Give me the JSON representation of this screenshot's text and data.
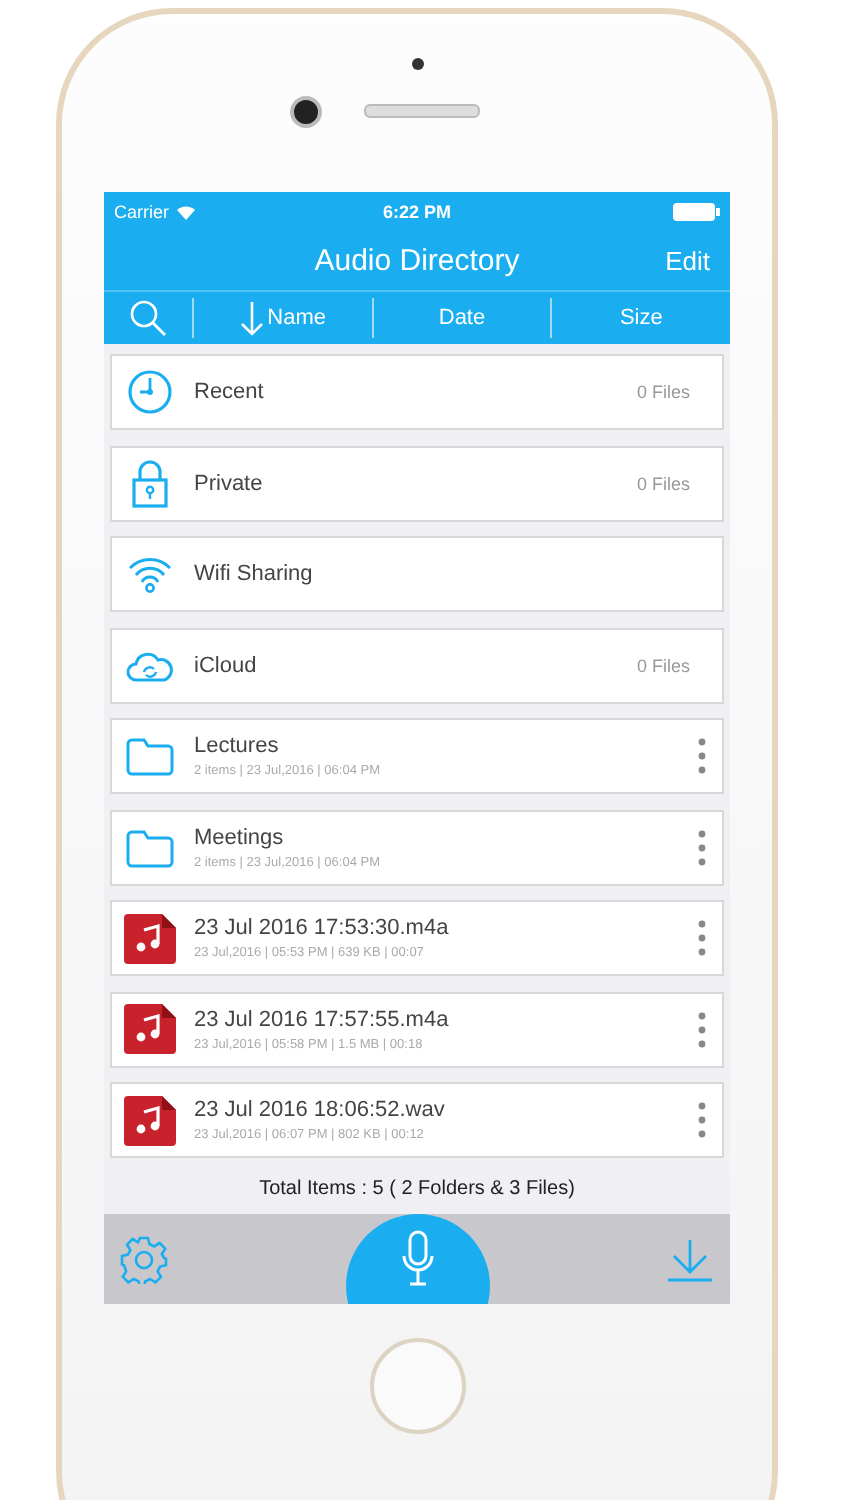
{
  "status_bar": {
    "carrier": "Carrier",
    "time": "6:22 PM"
  },
  "nav_bar": {
    "title": "Audio Directory",
    "edit": "Edit"
  },
  "sort_columns": [
    {
      "label": "Name",
      "sorted": true
    },
    {
      "label": "Date",
      "sorted": false
    },
    {
      "label": "Size",
      "sorted": false
    }
  ],
  "places": [
    {
      "kind": "recent",
      "label": "Recent",
      "count": "0 Files"
    },
    {
      "kind": "private",
      "label": "Private",
      "count": "0 Files"
    },
    {
      "kind": "wifi",
      "label": "Wifi Sharing"
    },
    {
      "kind": "icloud",
      "label": "iCloud",
      "count": "0 Files"
    }
  ],
  "items": [
    {
      "kind": "folder",
      "name": "Lectures",
      "details": "2 items | 23 Jul,2016 | 06:04 PM"
    },
    {
      "kind": "folder",
      "name": "Meetings",
      "details": "2 items | 23 Jul,2016 | 06:04 PM"
    },
    {
      "kind": "audio",
      "name": "23 Jul 2016 17:53:30.m4a",
      "details": "23 Jul,2016 | 05:53 PM | 639 KB | 00:07"
    },
    {
      "kind": "audio",
      "name": "23 Jul 2016 17:57:55.m4a",
      "details": "23 Jul,2016 | 05:58 PM | 1.5 MB | 00:18"
    },
    {
      "kind": "audio",
      "name": "23 Jul 2016 18:06:52.wav",
      "details": "23 Jul,2016 | 06:07 PM | 802 KB | 00:12"
    }
  ],
  "total": "Total Items : 5 ( 2 Folders & 3 Files)"
}
